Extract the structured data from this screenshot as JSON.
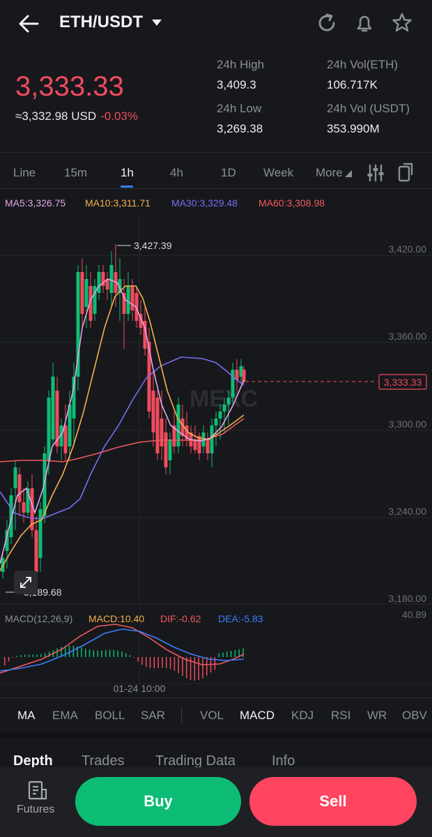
{
  "header": {
    "pair": "ETH/USDT"
  },
  "price": {
    "last": "3,333.33",
    "usd": "≈3,332.98 USD",
    "change": "-0.03%"
  },
  "stats": {
    "high_label": "24h High",
    "high": "3,409.3",
    "low_label": "24h Low",
    "low": "3,269.38",
    "vol_eth_label": "24h Vol(ETH)",
    "vol_eth": "106.717K",
    "vol_usdt_label": "24h Vol (USDT)",
    "vol_usdt": "353.990M"
  },
  "tabs": [
    "Line",
    "15m",
    "1h",
    "4h",
    "1D",
    "Week",
    "More"
  ],
  "ma_legend": {
    "ma5": "MA5:3,326.75",
    "ma10": "MA10:3,311.71",
    "ma30": "MA30:3,329.48",
    "ma60": "MA60:3,308.98"
  },
  "chart": {
    "y_ticks": [
      "3,420.00",
      "3,360.00",
      "3,300.00",
      "3,240.00",
      "3,180.00"
    ],
    "max_label": "3,427.39",
    "min_label": "3,189.68",
    "current_label": "3,333.33",
    "watermark": "MEXC",
    "macd_legend": {
      "params": "MACD(12,26,9)",
      "macd": "MACD:10.40",
      "dif": "DIF:-0.62",
      "dea": "DEA:-5.83"
    },
    "macd_top": "40.89",
    "time_label": "01-24 10:00"
  },
  "indicators": [
    "MA",
    "EMA",
    "BOLL",
    "SAR",
    "VOL",
    "MACD",
    "KDJ",
    "RSI",
    "WR",
    "OBV"
  ],
  "bottom_tabs": [
    "Depth",
    "Trades",
    "Trading Data",
    "Info"
  ],
  "footer": {
    "futures": "Futures",
    "buy": "Buy",
    "sell": "Sell"
  },
  "colors": {
    "up": "#0dbd75",
    "down": "#f04b5d",
    "ma5": "#e3a6e8",
    "ma10": "#f5b14c",
    "ma30": "#7b6cf2",
    "ma60": "#f0595f"
  }
}
